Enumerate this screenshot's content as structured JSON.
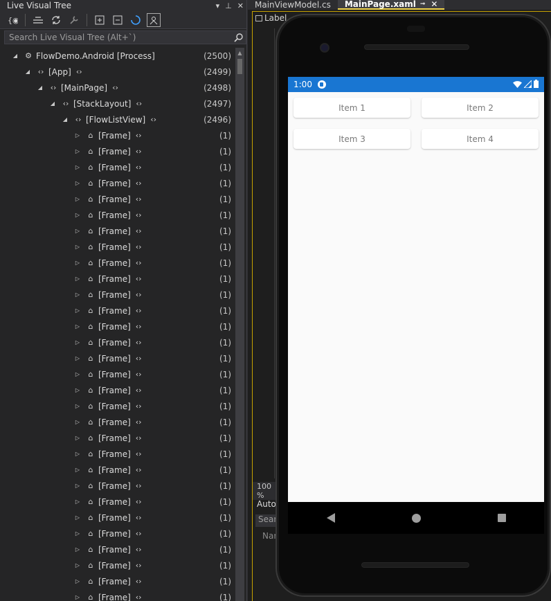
{
  "panel": {
    "title": "Live Visual Tree",
    "search_placeholder": "Search Live Visual Tree (Alt+`)"
  },
  "tree": {
    "root": {
      "label": "FlowDemo.Android [Process]",
      "count": "(2500)"
    },
    "app": {
      "label": "[App]",
      "count": "(2499)"
    },
    "mainpage": {
      "label": "[MainPage]",
      "count": "(2498)"
    },
    "stacklayout": {
      "label": "[StackLayout]",
      "count": "(2497)"
    },
    "flowlistview": {
      "label": "[FlowListView]",
      "count": "(2496)"
    },
    "frame_label": "[Frame]",
    "frame_count": "(1)",
    "frame_rows": 31
  },
  "editor": {
    "tabs": [
      {
        "label": "MainViewModel.cs"
      },
      {
        "label": "MainPage.xaml"
      }
    ],
    "label_chip": "Label",
    "zoom": "100 %",
    "props_autos": "Autos",
    "props_search": "Searc",
    "props_name": "Nar"
  },
  "device": {
    "time": "1:00",
    "items": [
      "Item 1",
      "Item 2",
      "Item 3",
      "Item 4"
    ]
  },
  "colors": {
    "status_bar": "#1976d2",
    "accent_yellow": "#c7a300"
  }
}
